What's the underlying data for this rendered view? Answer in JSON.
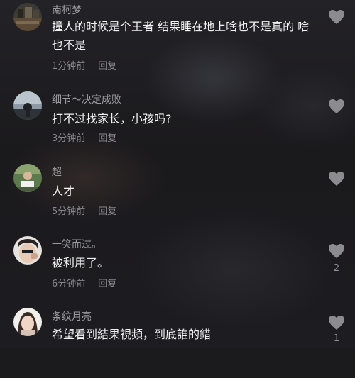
{
  "comments": [
    {
      "username": "南柯梦",
      "text": "撞人的时候是个王者 结果睡在地上啥也不是真的 啥也不是",
      "time": "1分钟前",
      "reply": "回复",
      "likes": ""
    },
    {
      "username": "细节～决定成败",
      "text": "打不过找家长，小孩吗?",
      "time": "3分钟前",
      "reply": "回复",
      "likes": ""
    },
    {
      "username": "超",
      "text": "人才",
      "time": "5分钟前",
      "reply": "回复",
      "likes": ""
    },
    {
      "username": "一笑而过。",
      "text": "被利用了。",
      "time": "6分钟前",
      "reply": "回复",
      "likes": "2"
    },
    {
      "username": "条纹月亮",
      "text": "希望看到結果視頻，到底誰的錯",
      "time": "",
      "reply": "",
      "likes": "1"
    }
  ],
  "icons": {
    "like": "heart-icon",
    "avatar": "avatar"
  },
  "colors": {
    "background": "#1b1a1d",
    "username": "#9a9aa0",
    "text": "#f2f2f2",
    "meta": "#87878c",
    "heart": "#8c8c90"
  }
}
